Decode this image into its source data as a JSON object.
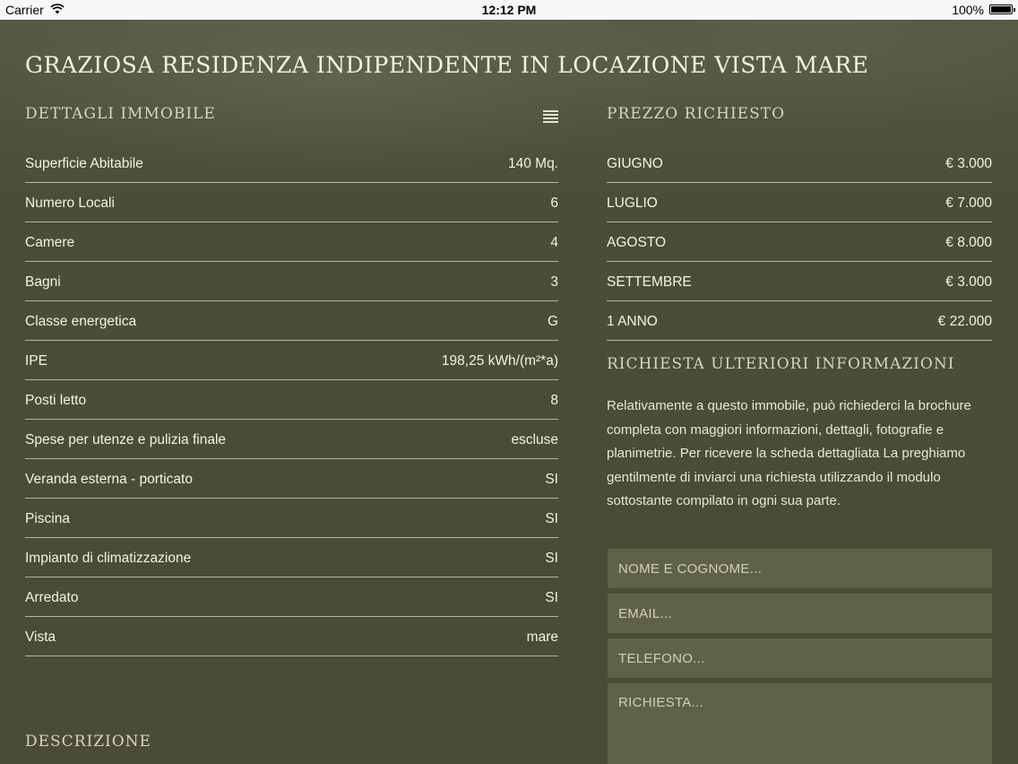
{
  "status_bar": {
    "carrier": "Carrier",
    "time": "12:12 PM",
    "battery": "100%"
  },
  "page": {
    "title": "GRAZIOSA RESIDENZA INDIPENDENTE IN LOCAZIONE VISTA MARE"
  },
  "details": {
    "title": "DETTAGLI IMMOBILE",
    "menu_icon": "list-icon",
    "rows": [
      {
        "label": "Superficie Abitabile",
        "value": "140 Mq."
      },
      {
        "label": "Numero Locali",
        "value": "6"
      },
      {
        "label": "Camere",
        "value": "4"
      },
      {
        "label": "Bagni",
        "value": "3"
      },
      {
        "label": "Classe energetica",
        "value": "G"
      },
      {
        "label": "IPE",
        "value": "198,25 kWh/(m²*a)"
      },
      {
        "label": "Posti letto",
        "value": "8"
      },
      {
        "label": "Spese per utenze e pulizia finale",
        "value": "escluse"
      },
      {
        "label": "Veranda esterna - porticato",
        "value": "SI"
      },
      {
        "label": "Piscina",
        "value": "SI"
      },
      {
        "label": "Impianto di climatizzazione",
        "value": "SI"
      },
      {
        "label": "Arredato",
        "value": "SI"
      },
      {
        "label": "Vista",
        "value": "mare"
      }
    ]
  },
  "description": {
    "title": "DESCRIZIONE"
  },
  "prices": {
    "title": "PREZZO RICHIESTO",
    "rows": [
      {
        "label": "GIUGNO",
        "value": "€ 3.000"
      },
      {
        "label": "LUGLIO",
        "value": "€ 7.000"
      },
      {
        "label": "AGOSTO",
        "value": "€ 8.000"
      },
      {
        "label": "SETTEMBRE",
        "value": "€ 3.000"
      },
      {
        "label": "1 ANNO",
        "value": "€ 22.000"
      }
    ]
  },
  "info_request": {
    "title": "RICHIESTA ULTERIORI INFORMAZIONI",
    "text": "Relativamente a questo immobile, può richiederci la brochure completa con maggiori informazioni, dettagli, fotografie e planimetrie. Per ricevere la scheda dettagliata La preghiamo gentilmente di inviarci una richiesta utilizzando il modulo sottostante compilato in ogni sua parte.",
    "form": {
      "name_placeholder": "NOME E COGNOME...",
      "name_value": "",
      "email_placeholder": "EMAIL...",
      "email_value": "",
      "phone_placeholder": "TELEFONO...",
      "phone_value": "",
      "request_placeholder": "RICHIESTA...",
      "request_value": ""
    }
  }
}
